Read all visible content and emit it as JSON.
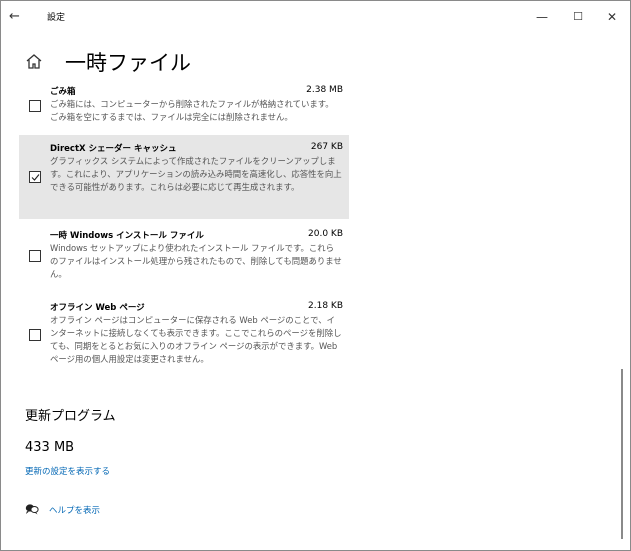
{
  "window": {
    "title": "設定",
    "back_glyph": "←",
    "minimize_glyph": "—",
    "maximize_glyph": "☐",
    "close_glyph": "✕"
  },
  "page": {
    "title": "一時ファイル"
  },
  "items": [
    {
      "name": "ごみ箱",
      "size": "2.38 MB",
      "checked": false,
      "description": "ごみ箱には、コンピューターから削除されたファイルが格納されています。ごみ箱を空にするまでは、ファイルは完全には削除されません。"
    },
    {
      "name": "DirectX シェーダー キャッシュ",
      "size": "267 KB",
      "checked": true,
      "description": "グラフィックス システムによって作成されたファイルをクリーンアップします。これにより、アプリケーションの読み込み時間を高速化し、応答性を向上できる可能性があります。これらは必要に応じて再生成されます。"
    },
    {
      "name": "一時 Windows インストール ファイル",
      "size": "20.0 KB",
      "checked": false,
      "description": "Windows セットアップにより使われたインストール ファイルです。これらのファイルはインストール処理から残されたもので、削除しても問題ありません。"
    },
    {
      "name": "オフライン Web ページ",
      "size": "2.18 KB",
      "checked": false,
      "description": "オフライン ページはコンピューターに保存される Web ページのことで、インターネットに接続しなくても表示できます。ここでこれらのページを削除しても、同期をとるとお気に入りのオフライン ページの表示ができます。Web ページ用の個人用設定は変更されません。"
    }
  ],
  "updates": {
    "title": "更新プログラム",
    "size": "433 MB",
    "link": "更新の設定を表示する"
  },
  "help": {
    "link": "ヘルプを表示"
  },
  "colors": {
    "link": "#0066b4",
    "highlight": "#e6e6e6",
    "desc_text": "#555555"
  }
}
